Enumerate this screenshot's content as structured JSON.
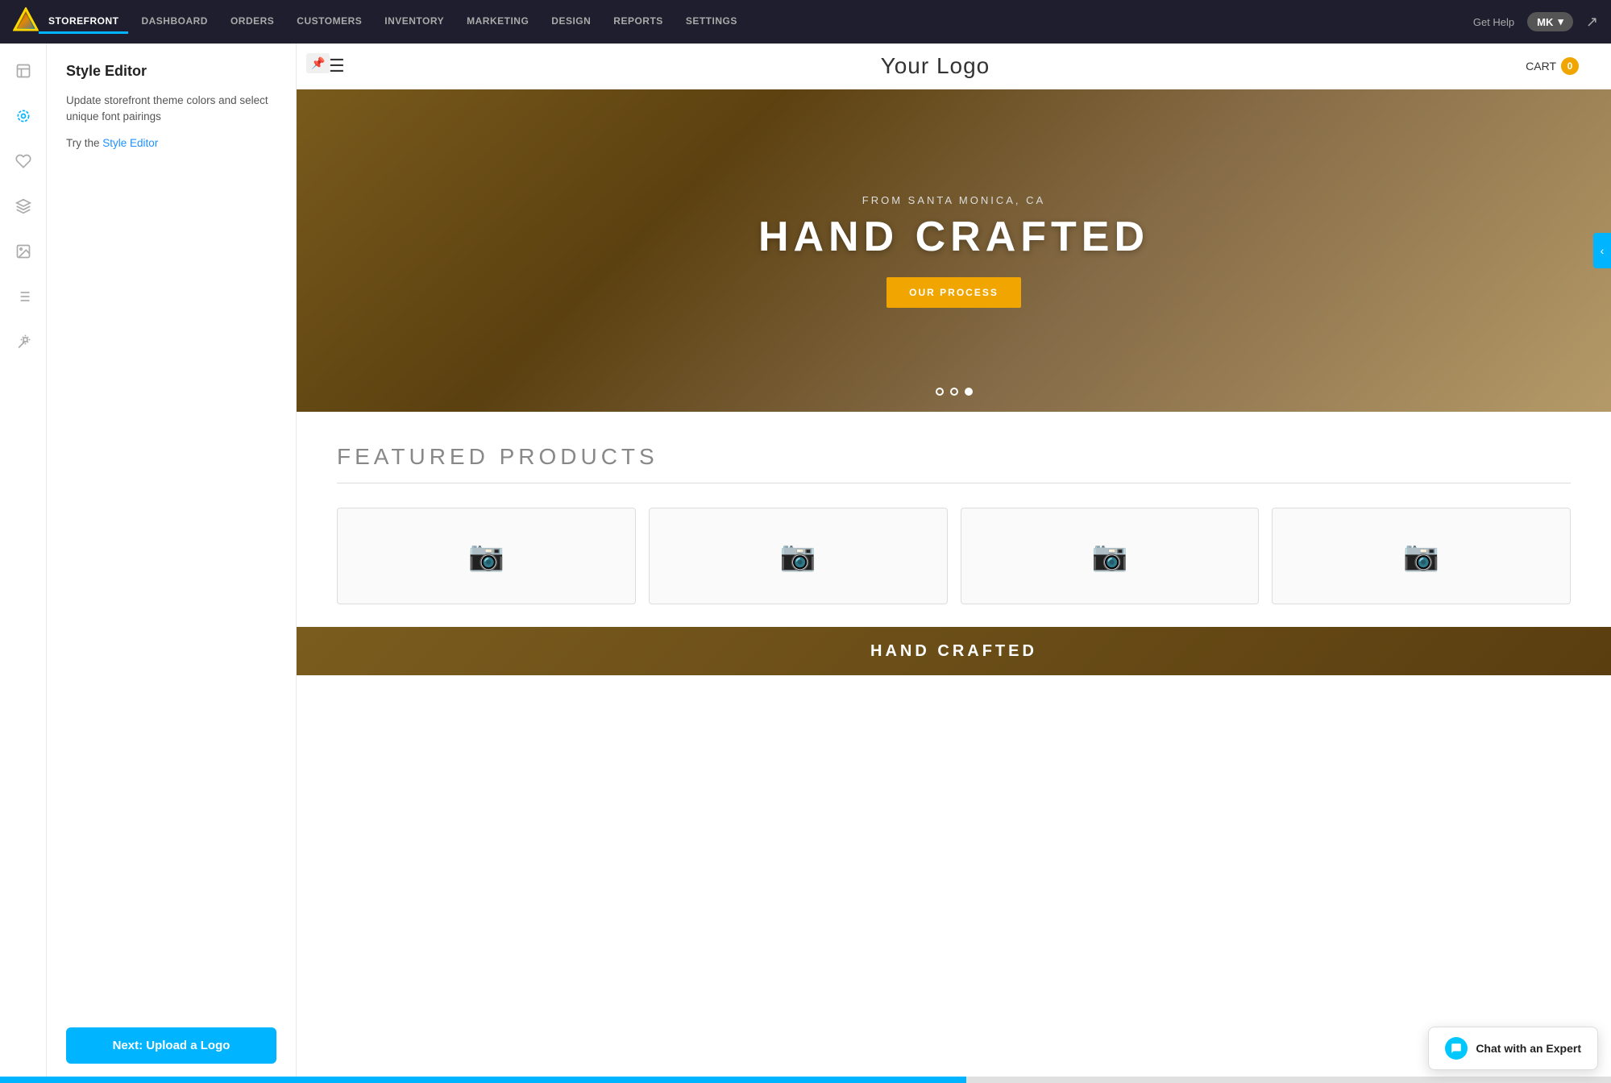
{
  "nav": {
    "items": [
      {
        "label": "STOREFRONT",
        "active": true
      },
      {
        "label": "DASHBOARD",
        "active": false
      },
      {
        "label": "ORDERS",
        "active": false
      },
      {
        "label": "CUSTOMERS",
        "active": false
      },
      {
        "label": "INVENTORY",
        "active": false
      },
      {
        "label": "MARKETING",
        "active": false
      },
      {
        "label": "DESIGN",
        "active": false
      },
      {
        "label": "REPORTS",
        "active": false
      },
      {
        "label": "SETTINGS",
        "active": false
      }
    ],
    "get_help": "Get Help",
    "user_initials": "MK",
    "external_icon": "⤴"
  },
  "style_editor": {
    "title": "Style Editor",
    "description": "Update storefront theme colors and select unique font pairings",
    "try_text": "Try the",
    "link_text": "Style Editor",
    "next_button": "Next: Upload a Logo"
  },
  "store_preview": {
    "logo": "Your Logo",
    "cart_label": "CART",
    "cart_count": "0",
    "hero": {
      "subtitle": "FROM SANTA MONICA, CA",
      "title": "HAND CRAFTED",
      "button": "OUR PROCESS",
      "dots": [
        {
          "active": false
        },
        {
          "active": false
        },
        {
          "active": true
        }
      ]
    },
    "featured": {
      "title": "FEATURED PRODUCTS",
      "products": [
        {
          "id": 1
        },
        {
          "id": 2
        },
        {
          "id": 3
        },
        {
          "id": 4
        }
      ]
    }
  },
  "chat": {
    "label": "Chat with an Expert"
  }
}
